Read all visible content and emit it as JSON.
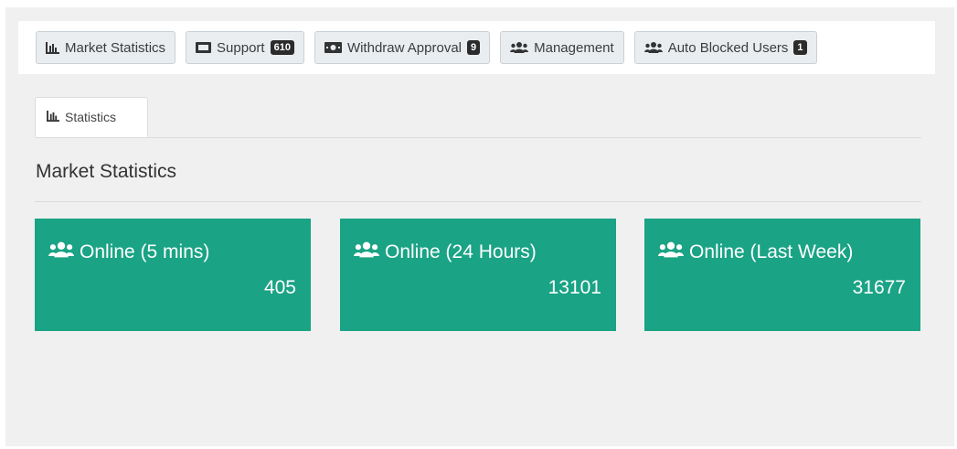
{
  "toolbar": {
    "buttons": [
      {
        "label": "Market Statistics",
        "icon": "bar-chart-icon",
        "badge": null
      },
      {
        "label": "Support",
        "icon": "ticket-icon",
        "badge": "610"
      },
      {
        "label": "Withdraw Approval",
        "icon": "money-icon",
        "badge": "9"
      },
      {
        "label": "Management",
        "icon": "users-icon",
        "badge": null
      },
      {
        "label": "Auto Blocked Users",
        "icon": "users-icon",
        "badge": "1"
      }
    ]
  },
  "tabs": [
    {
      "label": "Statistics",
      "icon": "bar-chart-icon",
      "active": true
    }
  ],
  "page_title": "Market Statistics",
  "cards": [
    {
      "label": "Online (5 mins)",
      "value": "405",
      "icon": "users-icon"
    },
    {
      "label": "Online (24 Hours)",
      "value": "13101",
      "icon": "users-icon"
    },
    {
      "label": "Online (Last Week)",
      "value": "31677",
      "icon": "users-icon"
    }
  ],
  "colors": {
    "card_bg": "#1aa385",
    "button_bg": "#e9edf0",
    "badge_bg": "#2b2b2b",
    "page_bg": "#f0f0f0"
  }
}
